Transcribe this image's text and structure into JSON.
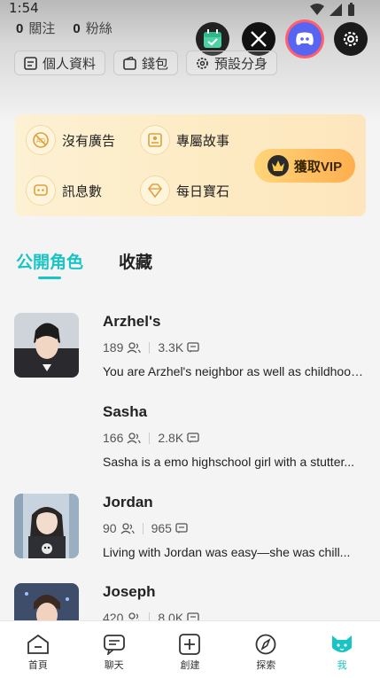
{
  "status": {
    "time": "1:54"
  },
  "follow": {
    "following_count": "0",
    "following_label": "關注",
    "followers_count": "0",
    "followers_label": "粉絲"
  },
  "top_actions": [
    "calendar-check-icon",
    "x-logo-icon",
    "discord-logo-icon",
    "gear-icon"
  ],
  "profile_buttons": [
    {
      "label": "個人資料",
      "icon": "profile-icon"
    },
    {
      "label": "錢包",
      "icon": "wallet-icon"
    },
    {
      "label": "預設分身",
      "icon": "gear-icon"
    }
  ],
  "vip": {
    "perks": [
      {
        "label": "沒有廣告",
        "icon": "no-ads-icon"
      },
      {
        "label": "專屬故事",
        "icon": "story-icon"
      },
      {
        "label": "訊息數",
        "icon": "message-count-icon"
      },
      {
        "label": "每日寶石",
        "icon": "gem-icon"
      }
    ],
    "button_label": "獲取VIP",
    "colors": {
      "card": "#fdebc4",
      "button": "#ffae4e"
    }
  },
  "tabs": [
    {
      "label": "公開角色",
      "active": true
    },
    {
      "label": "收藏",
      "active": false
    }
  ],
  "characters": [
    {
      "name": "Arzhel's",
      "users": "189",
      "messages": "3.3K",
      "description": "You are Arzhel's neighbor as well as childhood friend...",
      "has_avatar": true
    },
    {
      "name": "Sasha",
      "users": "166",
      "messages": "2.8K",
      "description": "Sasha is a emo highschool girl with a stutter...",
      "has_avatar": false
    },
    {
      "name": "Jordan",
      "users": "90",
      "messages": "965",
      "description": "Living with Jordan was easy—she was chill...",
      "has_avatar": true
    },
    {
      "name": "Joseph",
      "users": "420",
      "messages": "8.0K",
      "description": "",
      "has_avatar": true
    }
  ],
  "bottom_nav": [
    {
      "label": "首頁",
      "icon": "home-icon",
      "active": false
    },
    {
      "label": "聊天",
      "icon": "chat-icon",
      "active": false
    },
    {
      "label": "創建",
      "icon": "create-icon",
      "active": false
    },
    {
      "label": "探索",
      "icon": "compass-icon",
      "active": false
    },
    {
      "label": "我",
      "icon": "cat-face-icon",
      "active": true
    }
  ],
  "accent_color": "#19c4c4"
}
